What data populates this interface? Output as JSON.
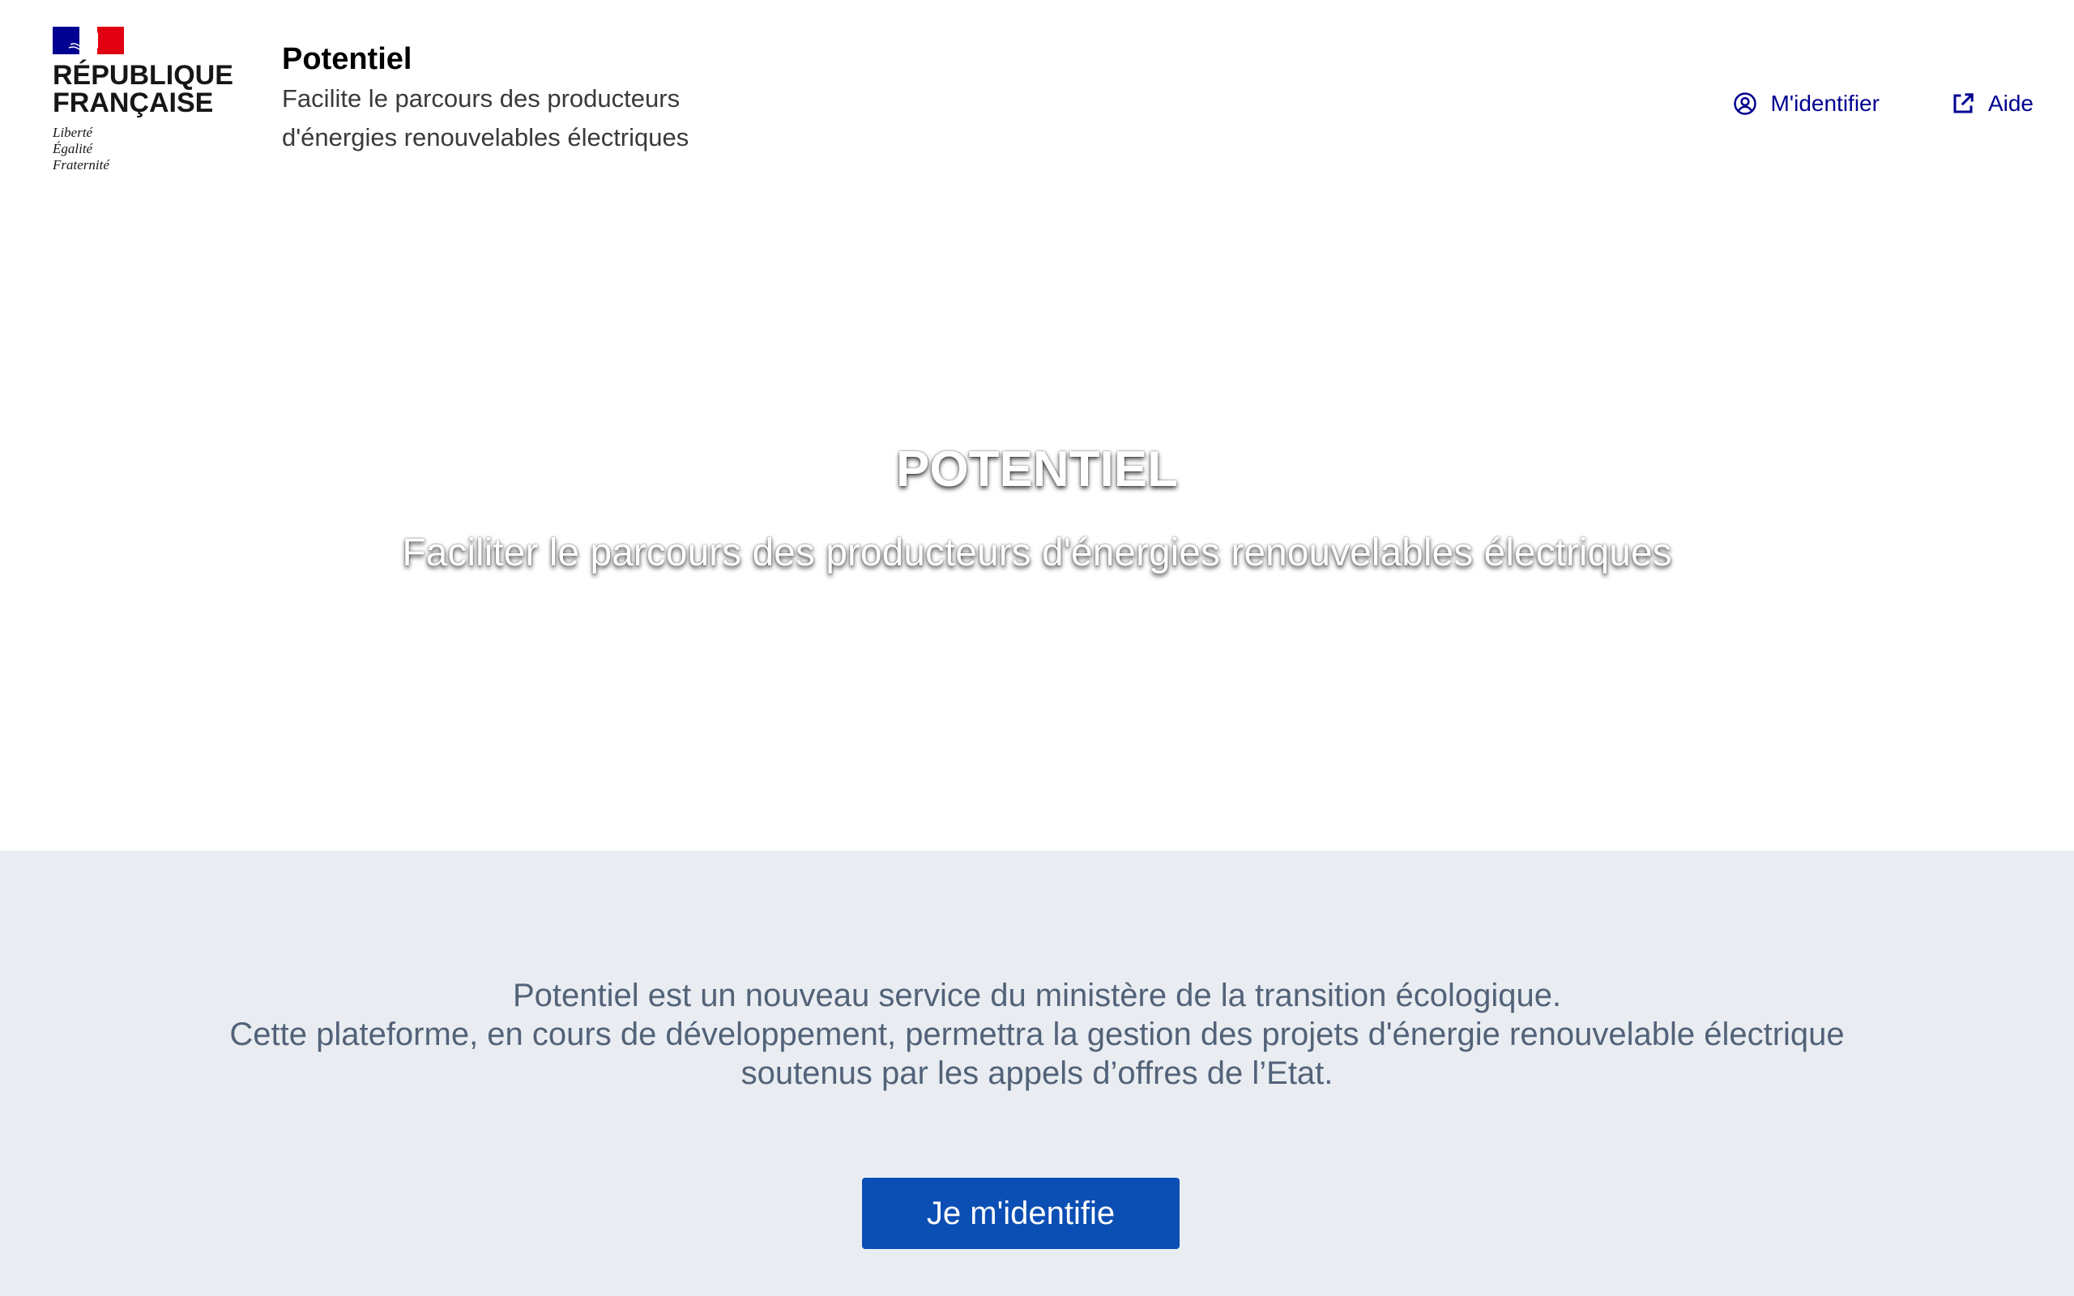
{
  "header": {
    "logo": {
      "line1": "RÉPUBLIQUE",
      "line2": "FRANÇAISE",
      "devise": [
        "Liberté",
        "Égalité",
        "Fraternité"
      ],
      "flag_colors": [
        "#000091",
        "#ffffff",
        "#e1000f"
      ]
    },
    "service_title": "Potentiel",
    "service_tagline": "Facilite le parcours des producteurs d'énergies renouvelables électriques",
    "tools": {
      "login": {
        "label": "M'identifier",
        "icon": "user-circle-icon"
      },
      "help": {
        "label": "Aide",
        "icon": "external-link-icon"
      }
    },
    "accent_color": "#000091"
  },
  "hero": {
    "title": "POTENTIEL",
    "subtitle": "Faciliter le parcours des producteurs d'énergies renouvelables électriques"
  },
  "info": {
    "lines": [
      "Potentiel est un nouveau service du ministère de la transition écologique.",
      "Cette plateforme, en cours de développement, permettra la gestion des projets d'énergie renouvelable électrique",
      "soutenus par les appels d’offres de l’Etat."
    ],
    "background": "#e9edf2",
    "text_color": "#526278",
    "cta_label": "Je m'identifie",
    "cta_color": "#0b4eb4"
  }
}
